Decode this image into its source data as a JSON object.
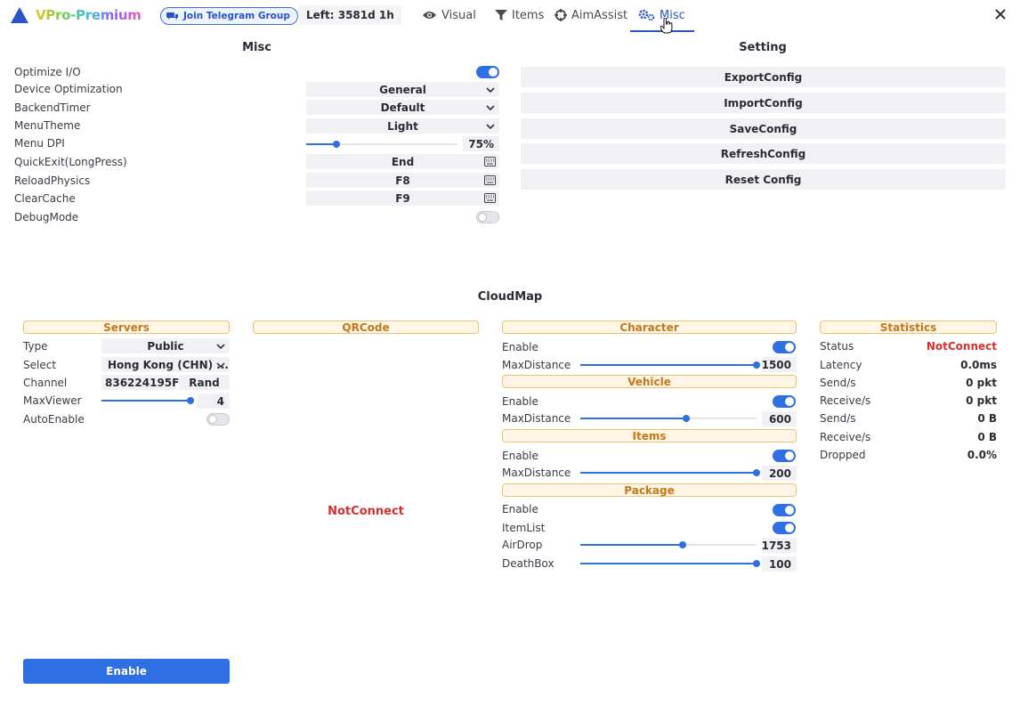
{
  "header": {
    "app_name": "VPro-Premium",
    "telegram_label": "Join Telegram Group",
    "time_left": "Left: 3581d 1h",
    "tabs": [
      {
        "label": "Visual",
        "icon": "eye-icon"
      },
      {
        "label": "Items",
        "icon": "filter-icon"
      },
      {
        "label": "AimAssist",
        "icon": "crosshair-icon"
      },
      {
        "label": "Misc",
        "icon": "gears-icon",
        "active": true
      }
    ]
  },
  "misc": {
    "title": "Misc",
    "rows": [
      {
        "label": "Optimize I/O",
        "type": "toggle",
        "on": true
      },
      {
        "label": "Device Optimization",
        "type": "combo",
        "value": "General"
      },
      {
        "label": "BackendTimer",
        "type": "combo",
        "value": "Default"
      },
      {
        "label": "MenuTheme",
        "type": "combo",
        "value": "Light"
      },
      {
        "label": "Menu DPI",
        "type": "slider",
        "value": "75%",
        "fraction": 0.2
      },
      {
        "label": "QuickExit(LongPress)",
        "type": "key",
        "value": "End"
      },
      {
        "label": "ReloadPhysics",
        "type": "key",
        "value": "F8"
      },
      {
        "label": "ClearCache",
        "type": "key",
        "value": "F9"
      },
      {
        "label": "DebugMode",
        "type": "toggle",
        "on": false
      }
    ]
  },
  "setting": {
    "title": "Setting",
    "buttons": [
      "ExportConfig",
      "ImportConfig",
      "SaveConfig",
      "RefreshConfig",
      "Reset Config"
    ]
  },
  "cloudmap": {
    "title": "CloudMap",
    "servers": {
      "title": "Servers",
      "type_label": "Type",
      "type_value": "Public",
      "select_label": "Select",
      "select_value": "Hong Kong (CHN) ...",
      "channel_label": "Channel",
      "channel_value": "836224195F",
      "rand_label": "Rand",
      "maxviewer_label": "MaxViewer",
      "maxviewer_value": "4",
      "maxviewer_fraction": 1.0,
      "autoenable_label": "AutoEnable",
      "autoenable_on": false,
      "enable_button": "Enable"
    },
    "qrcode": {
      "title": "QRCode",
      "status": "NotConnect"
    },
    "character": {
      "title": "Character",
      "enable_label": "Enable",
      "enable_on": true,
      "maxdist_label": "MaxDistance",
      "maxdist_value": "1500",
      "maxdist_fraction": 1.0
    },
    "vehicle": {
      "title": "Vehicle",
      "enable_label": "Enable",
      "enable_on": true,
      "maxdist_label": "MaxDistance",
      "maxdist_value": "600",
      "maxdist_fraction": 0.6
    },
    "items": {
      "title": "Items",
      "enable_label": "Enable",
      "enable_on": true,
      "maxdist_label": "MaxDistance",
      "maxdist_value": "200",
      "maxdist_fraction": 1.0
    },
    "package": {
      "title": "Package",
      "enable_label": "Enable",
      "enable_on": true,
      "itemlist_label": "ItemList",
      "itemlist_on": true,
      "airdrop_label": "AirDrop",
      "airdrop_value": "1753",
      "airdrop_fraction": 0.58,
      "deathbox_label": "DeathBox",
      "deathbox_value": "100",
      "deathbox_fraction": 1.0
    },
    "statistics": {
      "title": "Statistics",
      "rows": [
        {
          "label": "Status",
          "value": "NotConnect"
        },
        {
          "label": "Latency",
          "value": "0.0ms"
        },
        {
          "label": "Send/s",
          "value": "0 pkt"
        },
        {
          "label": "Receive/s",
          "value": "0 pkt"
        },
        {
          "label": "Send/s",
          "value": "0 B"
        },
        {
          "label": "Receive/s",
          "value": "0 B"
        },
        {
          "label": "Dropped",
          "value": "0.0%"
        }
      ]
    }
  },
  "colors": {
    "accent": "#2f6fe4",
    "warning_text": "#c9751a",
    "error": "#d53030"
  }
}
